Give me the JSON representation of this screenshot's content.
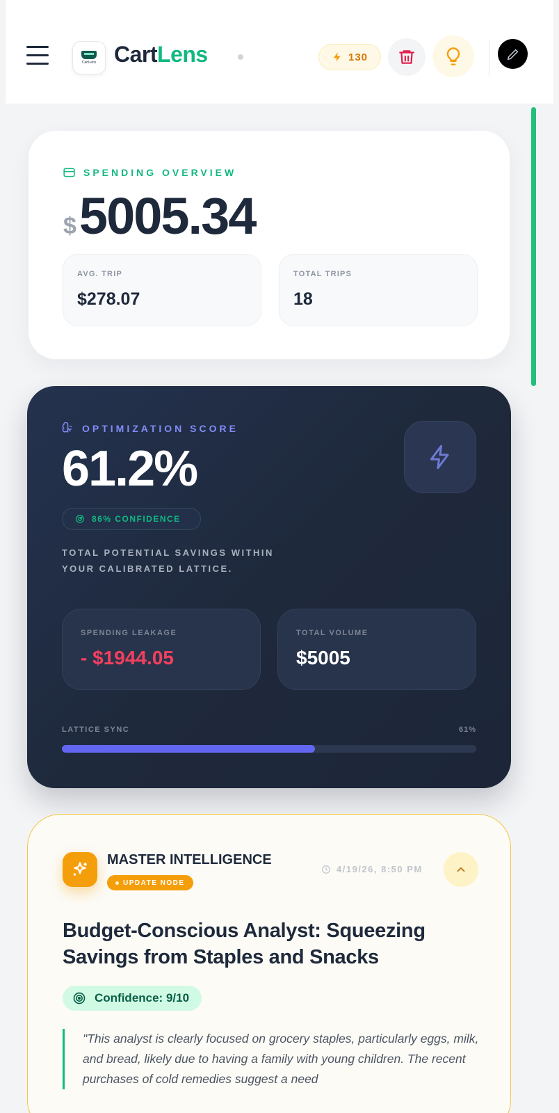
{
  "header": {
    "logo_mini": "CartLens",
    "brand_part1": "Cart",
    "brand_part2": "Lens",
    "points": "130"
  },
  "spending": {
    "label": "SPENDING OVERVIEW",
    "currency": "$",
    "total": "5005.34",
    "avg_trip_label": "AVG. TRIP",
    "avg_trip_value": "$278.07",
    "total_trips_label": "TOTAL TRIPS",
    "total_trips_value": "18"
  },
  "optimization": {
    "label": "OPTIMIZATION SCORE",
    "score": "61.2%",
    "confidence": "86% CONFIDENCE",
    "description": "TOTAL POTENTIAL SAVINGS WITHIN YOUR CALIBRATED LATTICE.",
    "leakage_label": "SPENDING LEAKAGE",
    "leakage_value": "- $1944.05",
    "volume_label": "TOTAL VOLUME",
    "volume_value": "$5005",
    "sync_label": "LATTICE SYNC",
    "sync_percent_text": "61%",
    "sync_fraction": 0.61
  },
  "master": {
    "title": "MASTER INTELLIGENCE",
    "badge": "UPDATE NODE",
    "timestamp": "4/19/26, 8:50 PM",
    "headline": "Budget-Conscious Analyst: Squeezing Savings from Staples and Snacks",
    "confidence": "Confidence: 9/10",
    "quote": "\"This analyst is clearly focused on grocery staples, particularly eggs, milk, and bread, likely due to having a family with young children. The recent purchases of cold remedies suggest a need"
  },
  "colors": {
    "accent_green": "#10b981",
    "accent_purple": "#818cf8",
    "accent_amber": "#f59e0b",
    "leak_red": "#f43f5e",
    "dark_card": "#1e293b"
  }
}
